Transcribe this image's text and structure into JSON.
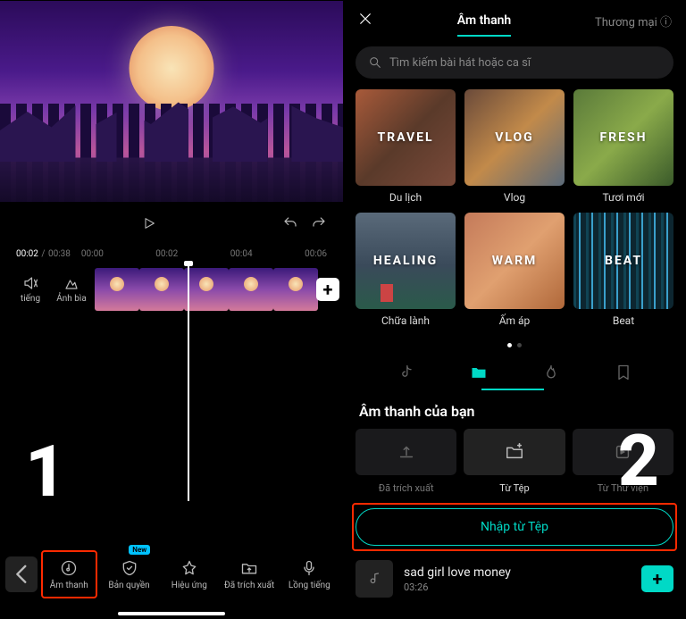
{
  "left": {
    "timeline": {
      "current": "00:02",
      "duration": "00:38",
      "marks": [
        "00:00",
        "00:02",
        "00:04",
        "00:06"
      ]
    },
    "trackButtons": {
      "tieng": "tiếng",
      "anhbia": "Ảnh bìa"
    },
    "bottomTools": [
      {
        "id": "amthanh",
        "label": "Âm thanh",
        "icon": "music",
        "highlighted": true
      },
      {
        "id": "banquyen",
        "label": "Bản quyền",
        "icon": "shield",
        "badge": "New"
      },
      {
        "id": "hieuung",
        "label": "Hiệu ứng",
        "icon": "star"
      },
      {
        "id": "datrichxuat",
        "label": "Đã trích xuất",
        "icon": "folder-out"
      },
      {
        "id": "longtieng",
        "label": "Lồng tiếng",
        "icon": "mic"
      }
    ],
    "clipAdd": "+",
    "bigNumber": "1"
  },
  "right": {
    "headerTabs": {
      "sound": "Âm thanh",
      "commercial": "Thương mại ⓘ"
    },
    "search": {
      "placeholder": "Tìm kiếm bài hát hoặc ca sĩ"
    },
    "categoriesRow1": [
      {
        "id": "travel",
        "overlay": "TRAVEL",
        "label": "Du lịch",
        "bg": "bg-travel"
      },
      {
        "id": "vlog",
        "overlay": "VLOG",
        "label": "Vlog",
        "bg": "bg-vlog"
      },
      {
        "id": "fresh",
        "overlay": "FRESH",
        "label": "Tươi mới",
        "bg": "bg-fresh"
      }
    ],
    "categoriesRow2": [
      {
        "id": "healing",
        "overlay": "HEALING",
        "label": "Chữa lành",
        "bg": "bg-healing"
      },
      {
        "id": "warm",
        "overlay": "WARM",
        "label": "Ấm áp",
        "bg": "bg-warm"
      },
      {
        "id": "beat",
        "overlay": "BEAT",
        "label": "Beat",
        "bg": "bg-beat"
      }
    ],
    "yourAudioTitle": "Âm thanh của bạn",
    "importOptions": [
      {
        "id": "extracted",
        "label": "Đã trích xuất",
        "icon": "extract"
      },
      {
        "id": "file",
        "label": "Từ Tệp",
        "icon": "folder-plus",
        "active": true
      },
      {
        "id": "library",
        "label": "Từ Thư viện",
        "icon": "library"
      }
    ],
    "importBtn": "Nhập từ Tệp",
    "song": {
      "title": "sad girl love money",
      "duration": "03:26",
      "add": "+"
    },
    "bigNumber": "2"
  }
}
